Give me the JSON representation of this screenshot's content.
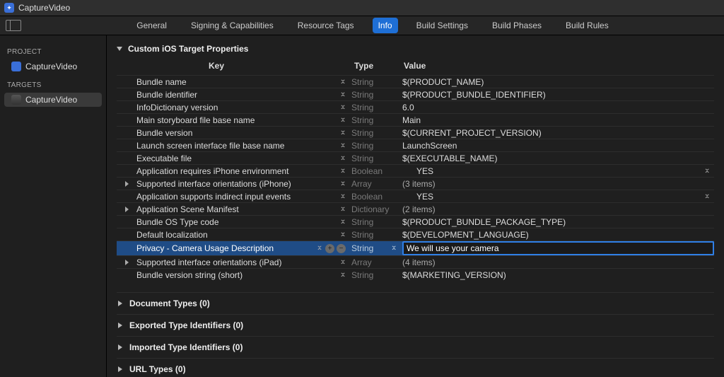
{
  "title": "CaptureVideo",
  "sidebar": {
    "project_heading": "PROJECT",
    "project_name": "CaptureVideo",
    "targets_heading": "TARGETS",
    "target_name": "CaptureVideo"
  },
  "tabs": [
    "General",
    "Signing & Capabilities",
    "Resource Tags",
    "Info",
    "Build Settings",
    "Build Phases",
    "Build Rules"
  ],
  "active_tab": "Info",
  "section_title": "Custom iOS Target Properties",
  "columns": {
    "key": "Key",
    "type": "Type",
    "value": "Value"
  },
  "rows": [
    {
      "key": "Bundle name",
      "type": "String",
      "value": "$(PRODUCT_NAME)"
    },
    {
      "key": "Bundle identifier",
      "type": "String",
      "value": "$(PRODUCT_BUNDLE_IDENTIFIER)"
    },
    {
      "key": "InfoDictionary version",
      "type": "String",
      "value": "6.0"
    },
    {
      "key": "Main storyboard file base name",
      "type": "String",
      "value": "Main"
    },
    {
      "key": "Bundle version",
      "type": "String",
      "value": "$(CURRENT_PROJECT_VERSION)"
    },
    {
      "key": "Launch screen interface file base name",
      "type": "String",
      "value": "LaunchScreen"
    },
    {
      "key": "Executable file",
      "type": "String",
      "value": "$(EXECUTABLE_NAME)"
    },
    {
      "key": "Application requires iPhone environment",
      "type": "Boolean",
      "value": "YES",
      "bool": true
    },
    {
      "key": "Supported interface orientations (iPhone)",
      "type": "Array",
      "value": "(3 items)",
      "children": true
    },
    {
      "key": "Application supports indirect input events",
      "type": "Boolean",
      "value": "YES",
      "bool": true
    },
    {
      "key": "Application Scene Manifest",
      "type": "Dictionary",
      "value": "(2 items)",
      "children": true
    },
    {
      "key": "Bundle OS Type code",
      "type": "String",
      "value": "$(PRODUCT_BUNDLE_PACKAGE_TYPE)"
    },
    {
      "key": "Default localization",
      "type": "String",
      "value": "$(DEVELOPMENT_LANGUAGE)"
    },
    {
      "key": "Privacy - Camera Usage Description",
      "type": "String",
      "value": "We will use your camera",
      "selected": true
    },
    {
      "key": "Supported interface orientations (iPad)",
      "type": "Array",
      "value": "(4 items)",
      "children": true
    },
    {
      "key": "Bundle version string (short)",
      "type": "String",
      "value": "$(MARKETING_VERSION)"
    }
  ],
  "bottom_sections": [
    "Document Types (0)",
    "Exported Type Identifiers (0)",
    "Imported Type Identifiers (0)",
    "URL Types (0)"
  ]
}
